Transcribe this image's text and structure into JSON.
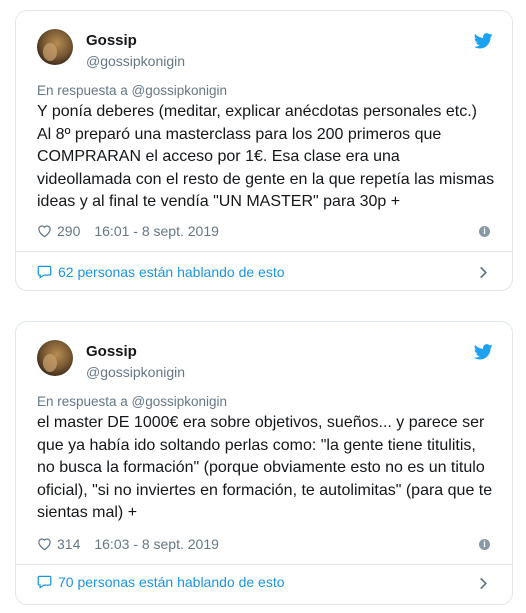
{
  "colors": {
    "accent": "#1da1f2",
    "link": "#1b95e0",
    "secondary": "#657786",
    "border": "#e1e8ed"
  },
  "tweets": [
    {
      "name": "Gossip",
      "handle": "@gossipkonigin",
      "reply_to": "En respuesta a @gossipkonigin",
      "text": "Y ponía deberes (meditar, explicar anécdotas personales etc.)\nAl 8º preparó una masterclass para los 200 primeros que\nCOMPRARAN el acceso por 1€. Esa clase era una\nvideollamada con el resto de gente en la que repetía las mismas\nideas y al final te vendía \"UN MASTER\" para 30p +",
      "likes": "290",
      "timestamp": "16:01 - 8 sept. 2019",
      "talking": "62 personas están hablando de esto"
    },
    {
      "name": "Gossip",
      "handle": "@gossipkonigin",
      "reply_to": "En respuesta a @gossipkonigin",
      "text": "el master DE 1000€ era sobre objetivos, sueños... y parece ser\nque ya había ido soltando perlas como: \"la gente tiene titulitis,\nno busca la formación\" (porque obviamente esto no es un titulo\noficial), \"si no inviertes en formación, te autolimitas\" (para que te\nsientas mal) +",
      "likes": "314",
      "timestamp": "16:03 - 8 sept. 2019",
      "talking": "70 personas están hablando de esto"
    }
  ],
  "icons": {
    "bird": "twitter-bird-icon",
    "heart": "heart-icon",
    "info": "info-icon",
    "bubble": "speech-bubble-icon",
    "chevron": "chevron-right-icon"
  }
}
